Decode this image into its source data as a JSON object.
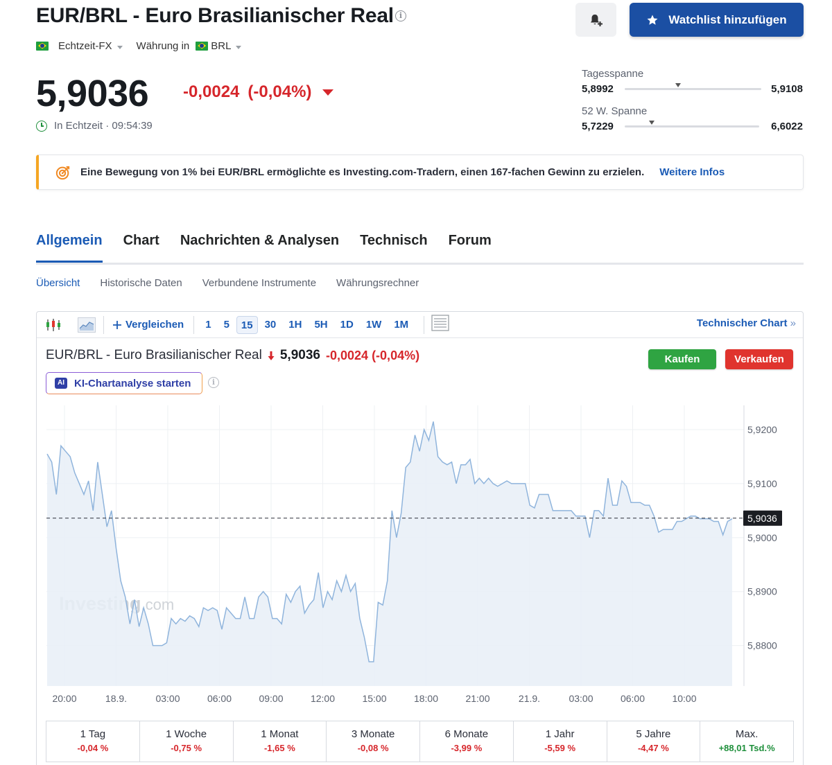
{
  "header": {
    "title": "EUR/BRL - Euro Brasilianischer Real",
    "feed_type": "Echtzeit-FX",
    "currency_prefix": "Währung in",
    "currency": "BRL",
    "watchlist_label": "Watchlist hinzufügen"
  },
  "quote": {
    "price": "5,9036",
    "change": "-0,0024",
    "change_pct": "(-0,04%)",
    "realtime_label": "In Echtzeit · 09:54:39"
  },
  "ranges": {
    "day": {
      "label": "Tagesspanne",
      "low": "5,8992",
      "high": "5,9108",
      "position": 0.39
    },
    "week52": {
      "label": "52 W. Spanne",
      "low": "5,7229",
      "high": "6,6022",
      "position": 0.2
    }
  },
  "banner": {
    "text": "Eine Bewegung von 1% bei EUR/BRL ermöglichte es Investing.com-Tradern, einen 167-fachen Gewinn zu erzielen.",
    "link": "Weitere Infos"
  },
  "tabs": [
    "Allgemein",
    "Chart",
    "Nachrichten & Analysen",
    "Technisch",
    "Forum"
  ],
  "subtabs": [
    "Übersicht",
    "Historische Daten",
    "Verbundene Instrumente",
    "Währungsrechner"
  ],
  "toolbar": {
    "compare_label": "Vergleichen",
    "intervals": [
      "1",
      "5",
      "15",
      "30",
      "1H",
      "5H",
      "1D",
      "1W",
      "1M"
    ],
    "active_interval": "15",
    "tech_chart_label": "Technischer Chart"
  },
  "chart_header": {
    "title": "EUR/BRL - Euro Brasilianischer Real",
    "price": "5,9036",
    "change": "-0,0024",
    "change_pct": "(-0,04%)",
    "ai_label": "KI-Chartanalyse starten",
    "buy_label": "Kaufen",
    "sell_label": "Verkaufen"
  },
  "watermark": {
    "main": "Investing",
    "suffix": ".com"
  },
  "colors": {
    "accent": "#1b5bb5",
    "negative": "#d6262b",
    "positive": "#1e8f3b",
    "line": "#8fb4dc",
    "area": "#e8eef7"
  },
  "chart_data": {
    "type": "area",
    "x_tick_labels": [
      "20:00",
      "18.9.",
      "03:00",
      "06:00",
      "09:00",
      "12:00",
      "15:00",
      "18:00",
      "21:00",
      "21.9.",
      "03:00",
      "06:00",
      "10:00"
    ],
    "y_tick_labels": [
      "5,9200",
      "5,9100",
      "5,9000",
      "5,8900",
      "5,8800"
    ],
    "ylim": [
      5.8725,
      5.9245
    ],
    "current_value": 5.9036,
    "current_label": "5,9036",
    "values": [
      5.9155,
      5.914,
      5.908,
      5.917,
      5.916,
      5.915,
      5.912,
      5.91,
      5.908,
      5.9105,
      5.905,
      5.914,
      5.908,
      5.902,
      5.905,
      5.898,
      5.892,
      5.889,
      5.884,
      5.8885,
      5.8835,
      5.887,
      5.884,
      5.88,
      5.88,
      5.88,
      5.8805,
      5.885,
      5.884,
      5.885,
      5.8845,
      5.8855,
      5.885,
      5.8835,
      5.887,
      5.8865,
      5.887,
      5.8865,
      5.883,
      5.887,
      5.886,
      5.885,
      5.885,
      5.889,
      5.885,
      5.885,
      5.889,
      5.89,
      5.889,
      5.885,
      5.885,
      5.884,
      5.8895,
      5.888,
      5.89,
      5.891,
      5.886,
      5.8875,
      5.8885,
      5.8935,
      5.887,
      5.89,
      5.8885,
      5.892,
      5.89,
      5.893,
      5.89,
      5.8915,
      5.885,
      5.8815,
      5.877,
      5.877,
      5.888,
      5.8875,
      5.892,
      5.905,
      5.9,
      5.9045,
      5.913,
      5.914,
      5.919,
      5.916,
      5.92,
      5.918,
      5.9215,
      5.915,
      5.914,
      5.9135,
      5.914,
      5.91,
      5.9135,
      5.9135,
      5.9145,
      5.91,
      5.911,
      5.91,
      5.911,
      5.91,
      5.9095,
      5.91,
      5.9105,
      5.91,
      5.91,
      5.91,
      5.91,
      5.906,
      5.9055,
      5.908,
      5.908,
      5.908,
      5.905,
      5.905,
      5.905,
      5.905,
      5.905,
      5.904,
      5.904,
      5.904,
      5.9,
      5.905,
      5.905,
      5.904,
      5.911,
      5.906,
      5.906,
      5.9105,
      5.9095,
      5.9065,
      5.9065,
      5.9065,
      5.906,
      5.906,
      5.904,
      5.901,
      5.9015,
      5.9015,
      5.9015,
      5.903,
      5.903,
      5.9035,
      5.904,
      5.904,
      5.9035,
      5.9035,
      5.9035,
      5.903,
      5.903,
      5.9005,
      5.903,
      5.9035
    ],
    "grid": true
  },
  "performance": [
    {
      "label": "1 Tag",
      "value": "-0,04 %",
      "positive": false
    },
    {
      "label": "1 Woche",
      "value": "-0,75 %",
      "positive": false
    },
    {
      "label": "1 Monat",
      "value": "-1,65 %",
      "positive": false
    },
    {
      "label": "3 Monate",
      "value": "-0,08 %",
      "positive": false
    },
    {
      "label": "6 Monate",
      "value": "-3,99 %",
      "positive": false
    },
    {
      "label": "1 Jahr",
      "value": "-5,59 %",
      "positive": false
    },
    {
      "label": "5 Jahre",
      "value": "-4,47 %",
      "positive": false
    },
    {
      "label": "Max.",
      "value": "+88,01 Tsd.%",
      "positive": true
    }
  ]
}
